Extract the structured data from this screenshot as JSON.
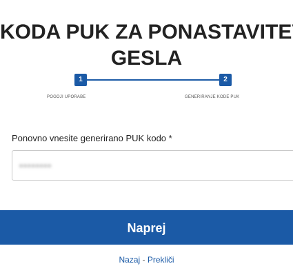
{
  "page": {
    "title_line_1": "KODA PUK ZA PONASTAVITEV",
    "title_line_2": "GESLA"
  },
  "stepper": {
    "steps": [
      {
        "number": "1",
        "label": "POGOJI UPORABE"
      },
      {
        "number": "2",
        "label": "GENERIRANJE KODE PUK"
      }
    ],
    "active_color": "#1b5aa6"
  },
  "form": {
    "puk_label": "Ponovno vnesite generirano PUK kodo *",
    "puk_value": "••••••••"
  },
  "actions": {
    "next_label": "Naprej",
    "back_label": "Nazaj",
    "separator": " - ",
    "cancel_label": "Prekliči"
  }
}
